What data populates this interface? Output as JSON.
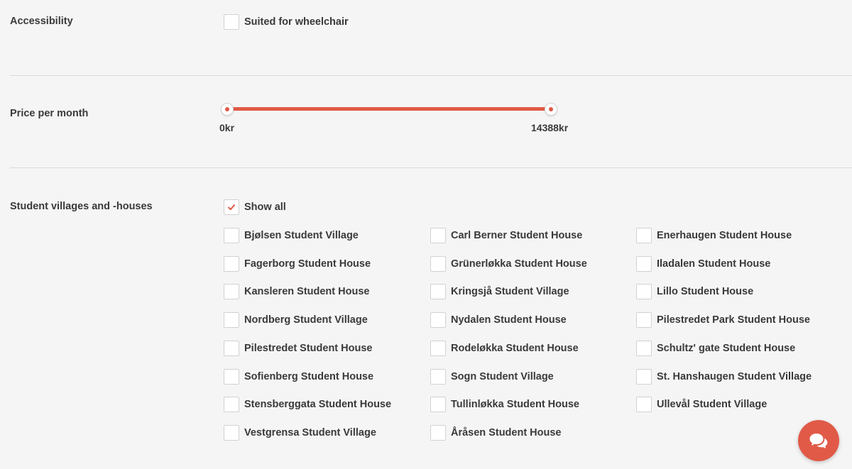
{
  "colors": {
    "accent": "#e05a47",
    "background": "#f5f5f5",
    "text": "#3a3a3a",
    "divider": "#d9d9d9"
  },
  "accessibility": {
    "label": "Accessibility",
    "option": {
      "label": "Suited for wheelchair",
      "checked": false
    }
  },
  "price": {
    "label": "Price per month",
    "min_label": "0kr",
    "max_label": "14388kr",
    "range_min": 0,
    "range_max": 14388,
    "selected_min": 0,
    "selected_max": 14388
  },
  "villages": {
    "label": "Student villages and -houses",
    "show_all": {
      "label": "Show all",
      "checked": true
    },
    "items": [
      {
        "label": "Bjølsen Student Village",
        "checked": false
      },
      {
        "label": "Carl Berner Student House",
        "checked": false
      },
      {
        "label": "Enerhaugen Student House",
        "checked": false
      },
      {
        "label": "Fagerborg Student House",
        "checked": false
      },
      {
        "label": "Grünerløkka Student House",
        "checked": false
      },
      {
        "label": "Iladalen Student House",
        "checked": false
      },
      {
        "label": "Kansleren Student House",
        "checked": false
      },
      {
        "label": "Kringsjå Student Village",
        "checked": false
      },
      {
        "label": "Lillo Student House",
        "checked": false
      },
      {
        "label": "Nordberg Student Village",
        "checked": false
      },
      {
        "label": "Nydalen Student House",
        "checked": false
      },
      {
        "label": "Pilestredet Park Student House",
        "checked": false
      },
      {
        "label": "Pilestredet Student House",
        "checked": false
      },
      {
        "label": "Rodeløkka Student House",
        "checked": false
      },
      {
        "label": "Schultz' gate Student House",
        "checked": false
      },
      {
        "label": "Sofienberg Student House",
        "checked": false
      },
      {
        "label": "Sogn Student Village",
        "checked": false
      },
      {
        "label": "St. Hanshaugen Student Village",
        "checked": false
      },
      {
        "label": "Stensberggata Student House",
        "checked": false
      },
      {
        "label": "Tullinløkka Student House",
        "checked": false
      },
      {
        "label": "Ullevål Student Village",
        "checked": false
      },
      {
        "label": "Vestgrensa Student Village",
        "checked": false
      },
      {
        "label": "Åråsen Student House",
        "checked": false
      }
    ]
  },
  "chat_button": {
    "icon": "chat-bubbles-icon"
  }
}
